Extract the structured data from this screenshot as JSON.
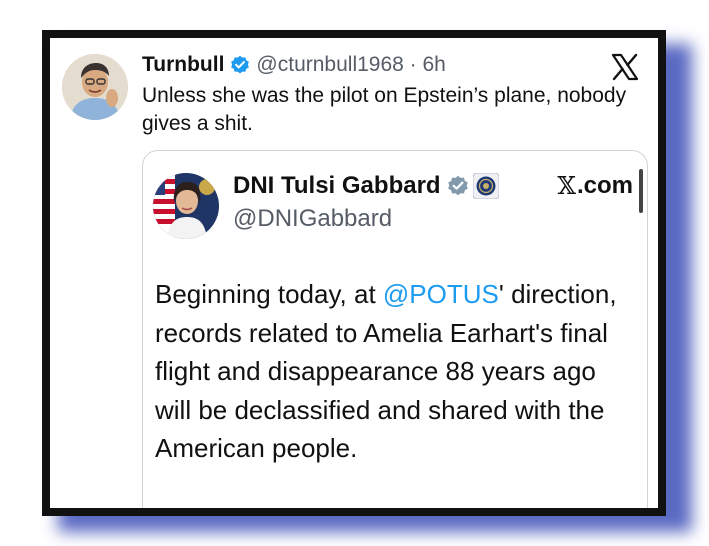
{
  "tweet": {
    "author_name": "Turnbull",
    "handle_time": "@cturnbull1968 · 6h",
    "text": "Unless she was the pilot on Epstein’s plane, nobody gives a shit."
  },
  "quoted_tweet": {
    "author_name": "DNI Tulsi Gabbard",
    "handle": "@DNIGabbard",
    "site_label": ".com",
    "body_prefix": "Beginning today, at ",
    "mention": "@POTUS",
    "body_suffix": "' direction, records related to Amelia Earhart's final flight and disappearance 88 years ago will be declassified and shared with the American people."
  },
  "colors": {
    "verified_blue": "#1d9bf0",
    "verified_gray": "#829aab",
    "mention_blue": "#1d9bf0",
    "frame_shadow": "#3d4fb8"
  },
  "icons": {
    "verified": "verified-badge-icon",
    "gov_verified": "gray-verified-badge-icon",
    "seal": "dni-seal-icon",
    "platform": "x-logo-icon"
  }
}
